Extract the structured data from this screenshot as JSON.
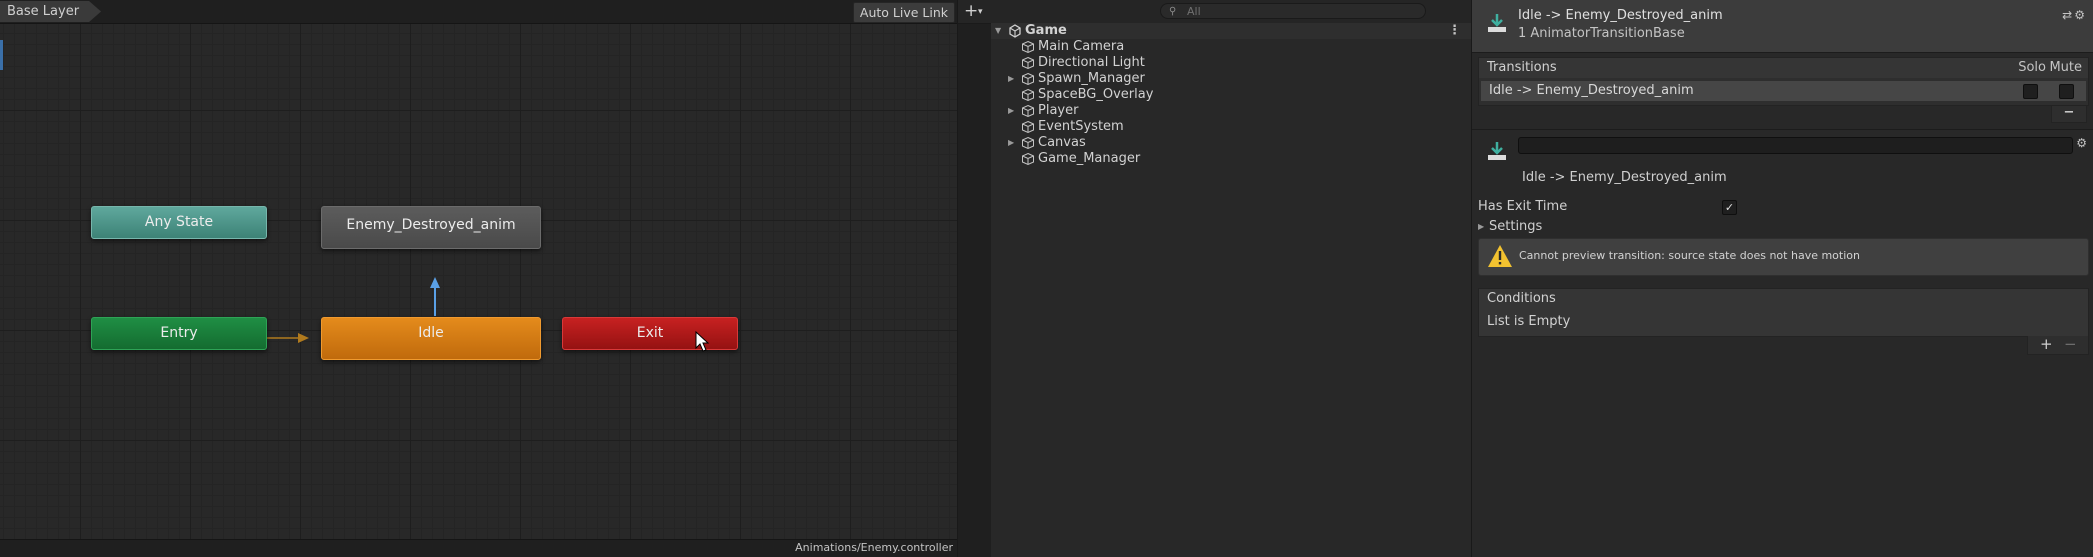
{
  "animator": {
    "breadcrumb": "Base Layer",
    "auto_live_link": "Auto Live Link",
    "states": {
      "any_state": "Any State",
      "enemy_destroyed": "Enemy_Destroyed_anim",
      "entry": "Entry",
      "idle": "Idle",
      "exit": "Exit"
    },
    "controller_path": "Animations/Enemy.controller"
  },
  "hierarchy": {
    "add_label": "+",
    "search_placeholder": "All",
    "scene": "Game",
    "items": [
      {
        "label": "Main Camera",
        "expandable": false
      },
      {
        "label": "Directional Light",
        "expandable": false
      },
      {
        "label": "Spawn_Manager",
        "expandable": true
      },
      {
        "label": "SpaceBG_Overlay",
        "expandable": false
      },
      {
        "label": "Player",
        "expandable": true
      },
      {
        "label": "EventSystem",
        "expandable": false
      },
      {
        "label": "Canvas",
        "expandable": true
      },
      {
        "label": "Game_Manager",
        "expandable": false
      }
    ]
  },
  "inspector": {
    "title": "Idle -> Enemy_Destroyed_anim",
    "subtitle": "1 AnimatorTransitionBase",
    "transitions_header": "Transitions",
    "solo_label": "Solo",
    "mute_label": "Mute",
    "transition_item": "Idle -> Enemy_Destroyed_anim",
    "minus_label": "−",
    "transition_name": "Idle -> Enemy_Destroyed_anim",
    "has_exit_time_label": "Has Exit Time",
    "has_exit_time": true,
    "settings_label": "Settings",
    "warning": "Cannot preview transition: source state does not have motion",
    "conditions_header": "Conditions",
    "conditions_empty": "List is Empty",
    "plus_label": "+",
    "minus2_label": "−"
  },
  "colors": {
    "any_state": "#4e9a8e",
    "entry": "#1b7d3b",
    "idle": "#d27b14",
    "exit": "#b01a1a",
    "default_state": "#525252",
    "transition_arrow": "#5aa0e6",
    "entry_arrow": "#b07a1e",
    "warning_yellow": "#f2c230"
  }
}
